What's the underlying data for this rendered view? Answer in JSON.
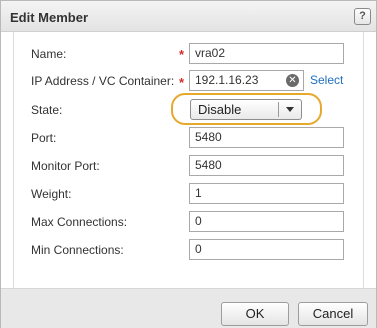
{
  "dialog": {
    "title": "Edit Member",
    "help_label": "?"
  },
  "form": {
    "name": {
      "label": "Name:",
      "value": "vra02",
      "required": true
    },
    "ip": {
      "label": "IP Address / VC Container:",
      "value": "192.1.16.23",
      "required": true,
      "select_link": "Select"
    },
    "state": {
      "label": "State:",
      "selected": "Disable"
    },
    "port": {
      "label": "Port:",
      "value": "5480"
    },
    "monitor_port": {
      "label": "Monitor Port:",
      "value": "5480"
    },
    "weight": {
      "label": "Weight:",
      "value": "1"
    },
    "max_connections": {
      "label": "Max Connections:",
      "value": "0"
    },
    "min_connections": {
      "label": "Min Connections:",
      "value": "0"
    }
  },
  "buttons": {
    "ok": "OK",
    "cancel": "Cancel"
  },
  "colors": {
    "required_star": "#d22f2f",
    "highlight": "#e6a92d",
    "link": "#1f6fbf"
  }
}
